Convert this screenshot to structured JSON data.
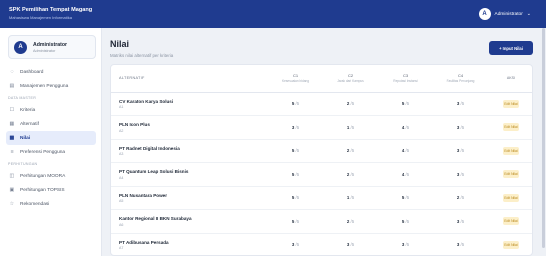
{
  "header": {
    "title": "SPK Pemilihan Tempat Magang",
    "subtitle": "Mahasiswa Manajemen Informatika",
    "user_initial": "A",
    "user_label": "Administrator"
  },
  "sidebar": {
    "profile": {
      "initial": "A",
      "name": "Administrator",
      "role": "Administrator"
    },
    "dashboard": "Dashboard",
    "users": "Manajemen Pengguna",
    "section_master": "DATA MASTER",
    "kriteria": "Kriteria",
    "alternatif": "Alternatif",
    "nilai": "Nilai",
    "preferensi": "Preferensi Pengguna",
    "section_calc": "PERHITUNGAN",
    "moora": "Perhitungan MOORA",
    "topsis": "Perhitungan TOPSIS",
    "rekomendasi": "Rekomendasi"
  },
  "main": {
    "title": "Nilai",
    "subtitle": "Matriks nilai alternatif per kriteria",
    "add_button": "+ Input Nilai"
  },
  "table": {
    "col_alt": "ALTERNATIF",
    "c1": {
      "code": "C1",
      "name": "Kesesuaian bidang"
    },
    "c2": {
      "code": "C2",
      "name": "Jarak dari Kampus"
    },
    "c3": {
      "code": "C3",
      "name": "Reputasi Instansi"
    },
    "c4": {
      "code": "C4",
      "name": "Fasilitas Penunjang"
    },
    "col_action": "AKSI",
    "scale": "/5",
    "edit_label": "Edit Nilai",
    "rows": [
      {
        "name": "CV Karaton Karya Solusi",
        "code": "A1",
        "c1": "5",
        "c2": "2",
        "c3": "5",
        "c4": "3"
      },
      {
        "name": "PLN Icon Plus",
        "code": "A2",
        "c1": "3",
        "c2": "1",
        "c3": "4",
        "c4": "3"
      },
      {
        "name": "PT Radnet Digital Indonesia",
        "code": "A3",
        "c1": "5",
        "c2": "2",
        "c3": "4",
        "c4": "3"
      },
      {
        "name": "PT Quantum Leap Solusi Bisnis",
        "code": "A4",
        "c1": "5",
        "c2": "2",
        "c3": "4",
        "c4": "3"
      },
      {
        "name": "PLN Nusantara Power",
        "code": "A5",
        "c1": "5",
        "c2": "1",
        "c3": "5",
        "c4": "2"
      },
      {
        "name": "Kantor Regional II BKN Surabaya",
        "code": "A6",
        "c1": "5",
        "c2": "2",
        "c3": "5",
        "c4": "3"
      },
      {
        "name": "PT Adibusana Persada",
        "code": "A7",
        "c1": "3",
        "c2": "3",
        "c3": "3",
        "c4": "3"
      }
    ]
  }
}
